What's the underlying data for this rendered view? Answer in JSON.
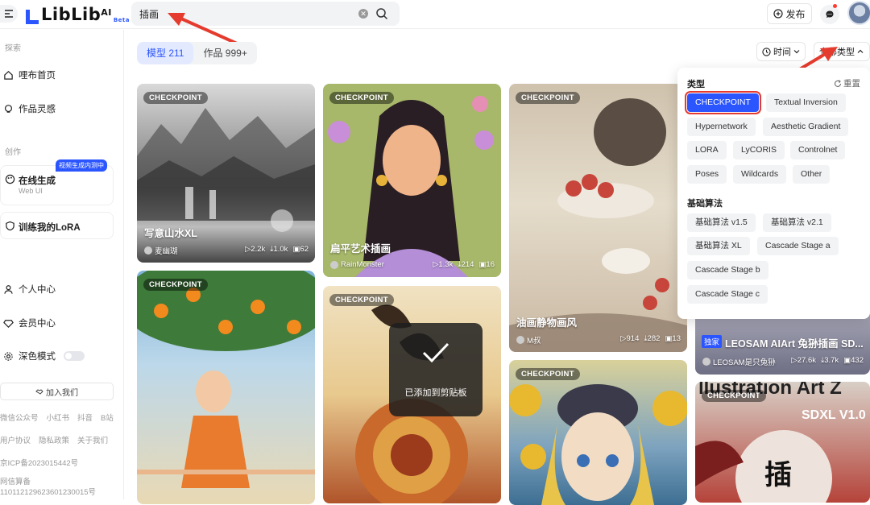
{
  "header": {
    "logo_text": "LibLib",
    "logo_ai": "AI",
    "logo_beta": "Beta",
    "search_value": "插画",
    "publish_label": "发布"
  },
  "sidebar": {
    "explore_label": "探索",
    "home": "哩布首页",
    "inspiration": "作品灵感",
    "create_label": "创作",
    "online_gen": "在线生成",
    "online_gen_sub": "Web UI",
    "online_gen_badge": "视频生成内测中",
    "train_lora": "训练我的LoRA",
    "personal": "个人中心",
    "membership": "会员中心",
    "dark_mode": "深色模式",
    "join": "加入我们",
    "links_row1": [
      "微信公众号",
      "小红书",
      "抖音",
      "B站"
    ],
    "links_row2": [
      "用户协议",
      "隐私政策",
      "关于我们"
    ],
    "icp": "京ICP备2023015442号",
    "net_reg_label": "网信算备",
    "net_reg_no": "110112129623601230015号"
  },
  "tabs": {
    "models": "模型 211",
    "works": "作品 999+"
  },
  "filters": {
    "time": "时间",
    "all_types": "全部类型"
  },
  "cards": [
    {
      "badge": "CHECKPOINT",
      "title": "写意山水XL",
      "author": "麦幽瑚",
      "runs": "2.2k",
      "downloads": "1.0k",
      "images": "62"
    },
    {
      "badge": "CHECKPOINT",
      "title": "扁平艺术插画",
      "author": "RainMonster",
      "runs": "1.3k",
      "downloads": "214",
      "images": "16"
    },
    {
      "badge": "CHECKPOINT",
      "title": "油画静物画风",
      "author": "M叔",
      "runs": "914",
      "downloads": "282",
      "images": "13"
    },
    {
      "badge": "CHECKPOINT"
    },
    {
      "badge": "CHECKPOINT"
    },
    {
      "badge": "CHECKPOINT"
    },
    {
      "tag": "独家",
      "title": "LEOSAM AIArt 兔狲插画 SD...",
      "author": "LEOSAM是只兔狲",
      "runs": "27.6k",
      "downloads": "3.7k",
      "images": "432"
    },
    {
      "badge": "CHECKPOINT",
      "bg_text": "llustration Art Z",
      "bg_sub": "SDXL V1.0",
      "bg_char": "插"
    }
  ],
  "toast": "已添加到剪贴板",
  "type_panel": {
    "type_heading": "类型",
    "reset": "重置",
    "types": [
      "CHECKPOINT",
      "Textual Inversion",
      "Hypernetwork",
      "Aesthetic Gradient",
      "LORA",
      "LyCORIS",
      "Controlnet",
      "Poses",
      "Wildcards",
      "Other"
    ],
    "algo_heading": "基础算法",
    "algos": [
      "基础算法 v1.5",
      "基础算法 v2.1",
      "基础算法 XL",
      "Cascade Stage a",
      "Cascade Stage b",
      "Cascade Stage c"
    ]
  },
  "colors": {
    "accent": "#2b55ff",
    "annotation": "#e53b2e"
  }
}
